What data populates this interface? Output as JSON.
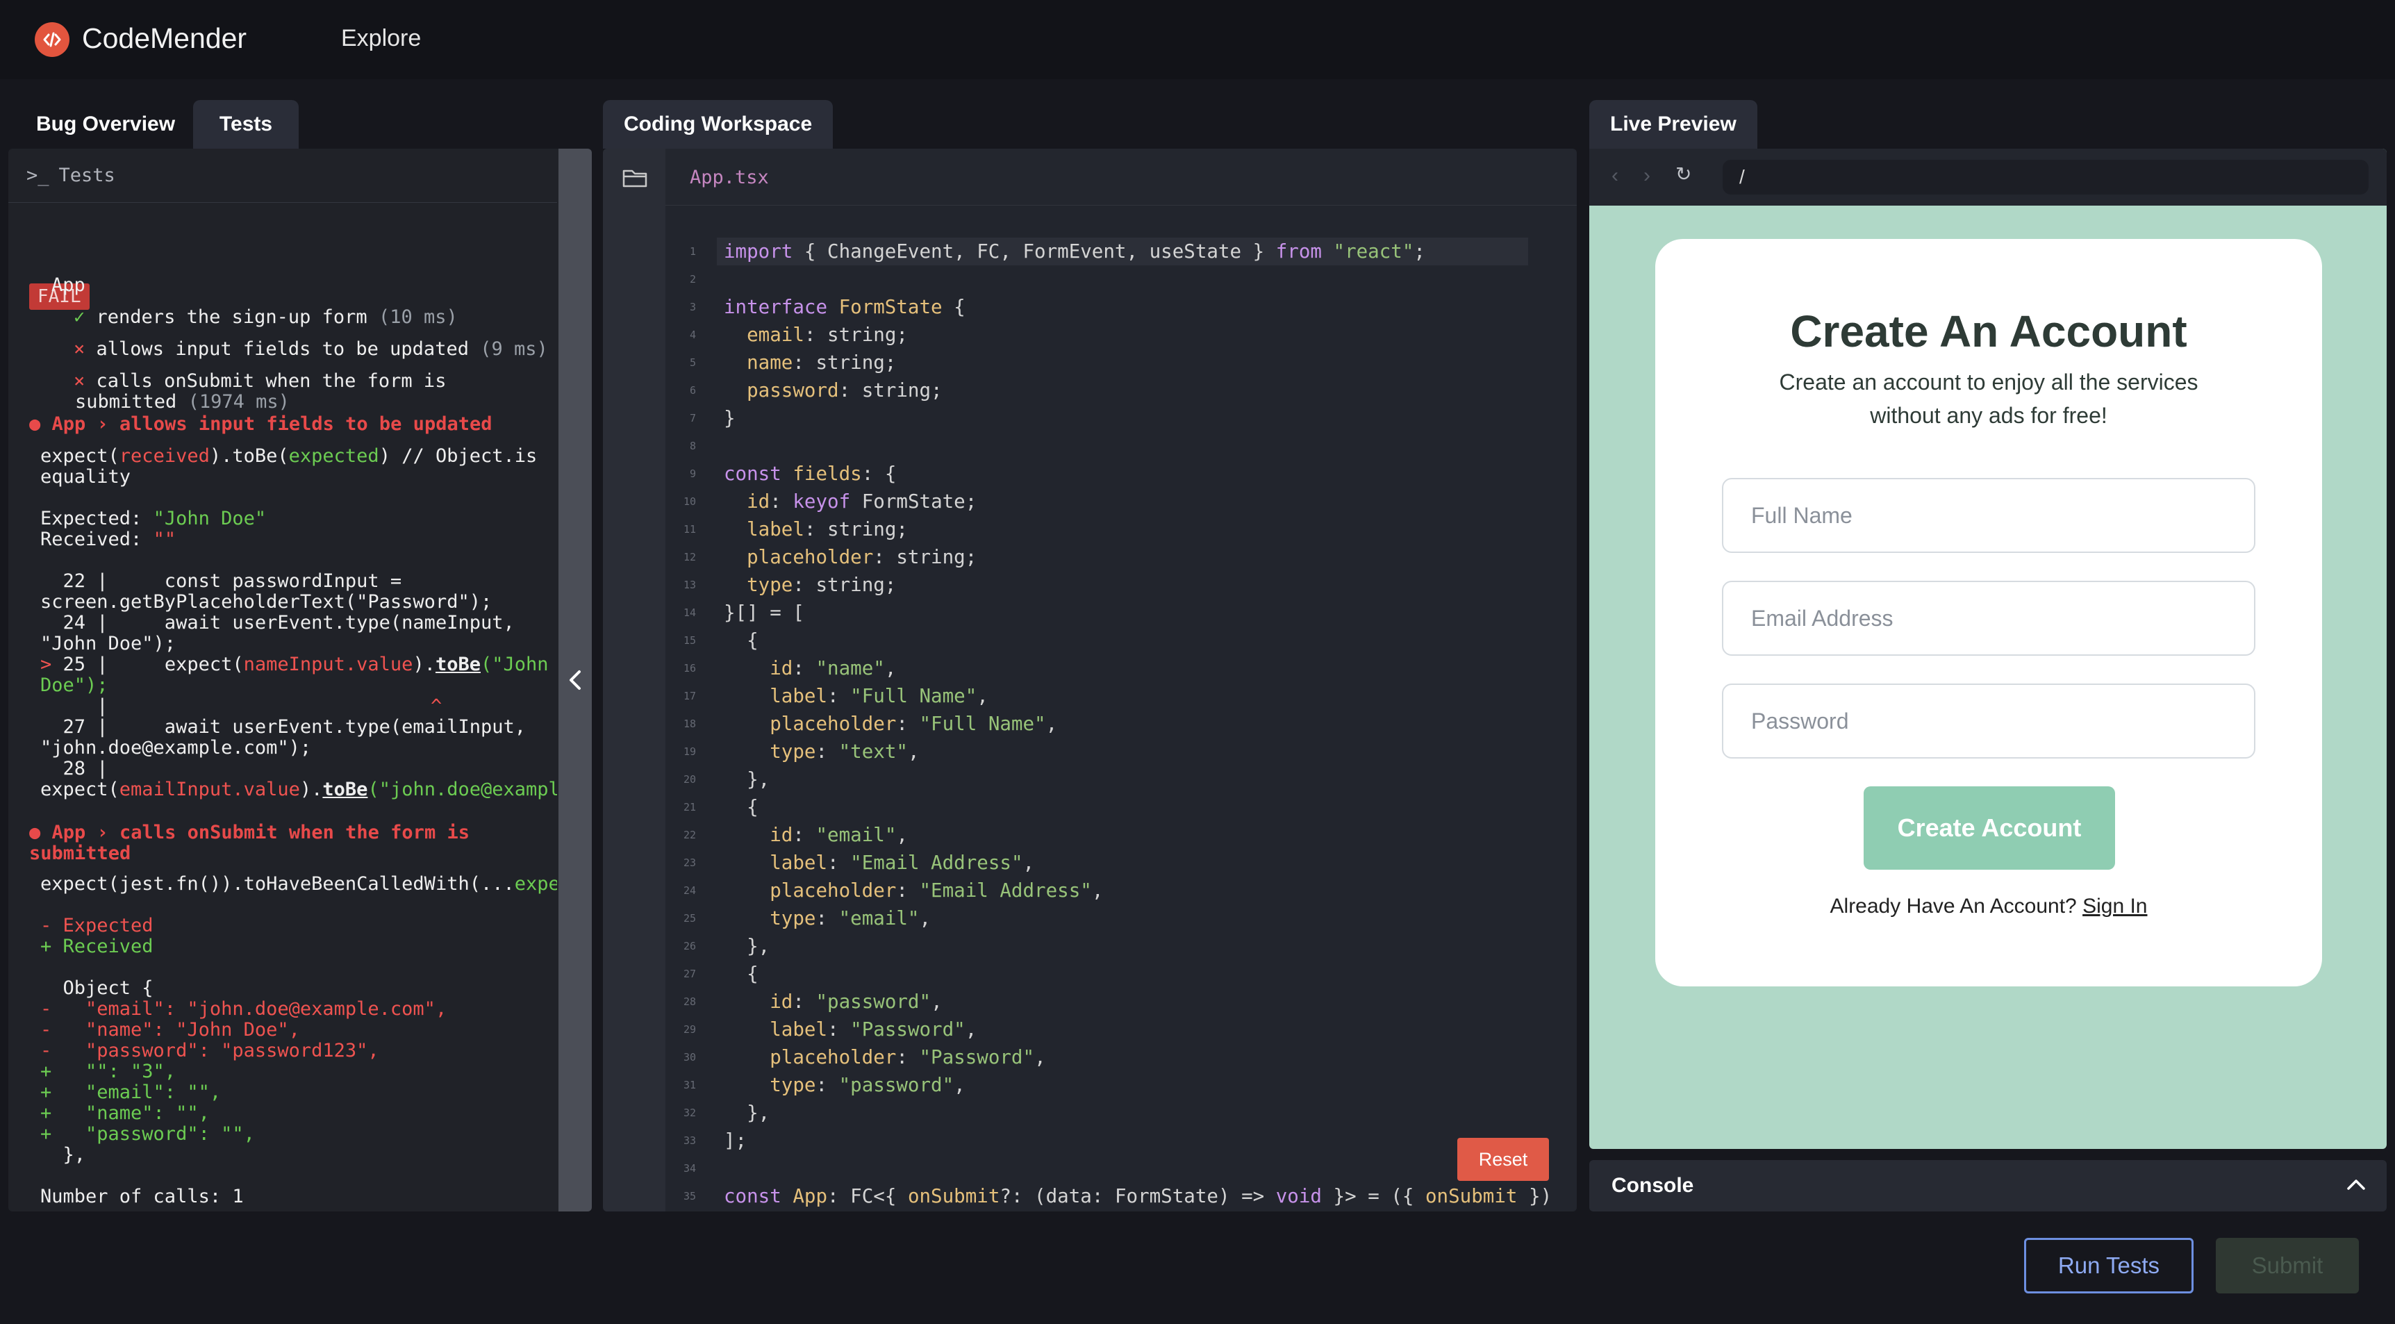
{
  "app": {
    "brand": "CodeMender",
    "nav_explore": "Explore"
  },
  "tabs": {
    "bug_overview": "Bug Overview",
    "tests": "Tests",
    "coding_workspace": "Coding Workspace",
    "live_preview": "Live Preview"
  },
  "tests_panel": {
    "header": "Tests",
    "fail_badge": "FAIL",
    "suite": "App",
    "results": [
      {
        "mark": "✓",
        "name": "renders the sign-up form",
        "time": "(10 ms)",
        "status": "pass"
      },
      {
        "mark": "×",
        "name": "allows input fields to be updated",
        "time": "(9 ms)",
        "status": "fail"
      },
      {
        "mark": "×",
        "name": "calls onSubmit when the form is",
        "name2": "submitted",
        "time": "(1974 ms)",
        "status": "fail"
      }
    ],
    "error1": {
      "title": "● App › allows input fields to be updated",
      "expect_a": "expect(",
      "expect_received": "received",
      "expect_b": ").toBe(",
      "expect_expected": "expected",
      "expect_c": ") // Object.is",
      "equality": "equality",
      "expected_label": "Expected: ",
      "expected_val": "\"John Doe\"",
      "received_label": "Received: ",
      "received_val": "\"\"",
      "l1": "  22 |     const passwordInput =",
      "l2": "screen.getByPlaceholderText(\"Password\");",
      "l3": "  24 |     await userEvent.type(nameInput,",
      "l4": "\"John Doe\");",
      "l5_mark": "> ",
      "l5_a": "25 |     expect(",
      "l5_b": "nameInput.value",
      "l5_c": ").",
      "l5_d": "toBe",
      "l5_e": "(\"John",
      "l6": "Doe\");",
      "l7_a": "     |",
      "l7_caret": "^",
      "l8": "  27 |     await userEvent.type(emailInput,",
      "l9": "\"john.doe@example.com\");",
      "l10": "  28 |",
      "l11_a": "expect(",
      "l11_b": "emailInput.value",
      "l11_c": ").",
      "l11_d": "toBe",
      "l11_e": "(\"john.doe@example."
    },
    "error2": {
      "title1": "● App › calls onSubmit when the form is",
      "title2": "submitted",
      "expect_a": "expect(jest.fn()).toHaveBeenCalledWith(...",
      "expect_b": "expect",
      "minus_expected": "- Expected",
      "plus_received": "+ Received",
      "object_open": "  Object {",
      "diff_removed": [
        "-   \"email\": \"john.doe@example.com\",",
        "-   \"name\": \"John Doe\",",
        "-   \"password\": \"password123\","
      ],
      "diff_added": [
        "+   \"\": \"3\",",
        "+   \"email\": \"\",",
        "+   \"name\": \"\",",
        "+   \"password\": \"\","
      ],
      "object_close": "  },",
      "calls": "Number of calls: 1"
    }
  },
  "code": {
    "file": "App.tsx",
    "reset_label": "Reset"
  },
  "preview": {
    "url": "/",
    "title": "Create An Account",
    "subtitle_1": "Create an account to enjoy all the services",
    "subtitle_2": "without any ads for free!",
    "full_name_placeholder": "Full Name",
    "email_placeholder": "Email Address",
    "password_placeholder": "Password",
    "create_button": "Create Account",
    "already": "Already Have An Account? ",
    "sign_in": "Sign In"
  },
  "console": {
    "label": "Console"
  },
  "footer": {
    "run_tests": "Run Tests",
    "submit": "Submit"
  },
  "colors": {
    "accent": "#e2553e",
    "preview_bg": "#b0d8c7",
    "create_btn": "#8fcdb2",
    "run_border": "#6d8fe0"
  }
}
